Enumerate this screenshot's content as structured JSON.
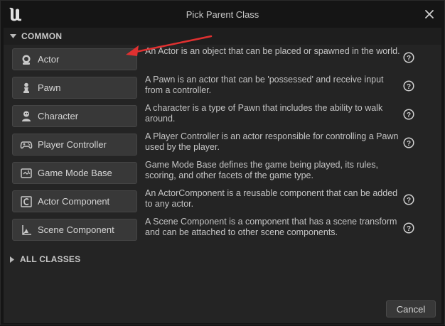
{
  "window": {
    "title": "Pick Parent Class"
  },
  "sections": {
    "common": "COMMON",
    "all_classes": "ALL CLASSES"
  },
  "classes": [
    {
      "label": "Actor",
      "icon": "actor-icon",
      "description": "An Actor is an object that can be placed or spawned in the world.",
      "help": true
    },
    {
      "label": "Pawn",
      "icon": "pawn-icon",
      "description": "A Pawn is an actor that can be 'possessed' and receive input from a controller.",
      "help": true
    },
    {
      "label": "Character",
      "icon": "character-icon",
      "description": "A character is a type of Pawn that includes the ability to walk around.",
      "help": true
    },
    {
      "label": "Player Controller",
      "icon": "gamepad-icon",
      "description": "A Player Controller is an actor responsible for controlling a Pawn used by the player.",
      "help": true
    },
    {
      "label": "Game Mode Base",
      "icon": "game-mode-icon",
      "description": "Game Mode Base defines the game being played, its rules, scoring, and other facets of the game type.",
      "help": false
    },
    {
      "label": "Actor Component",
      "icon": "actor-component-icon",
      "description": "An ActorComponent is a reusable component that can be added to any actor.",
      "help": true
    },
    {
      "label": "Scene Component",
      "icon": "scene-component-icon",
      "description": "A Scene Component is a component that has a scene transform and can be attached to other scene components.",
      "help": true
    }
  ],
  "footer": {
    "cancel_label": "Cancel"
  },
  "colors": {
    "annotation_arrow": "#e03030",
    "panel": "#242424",
    "button": "#383838"
  }
}
